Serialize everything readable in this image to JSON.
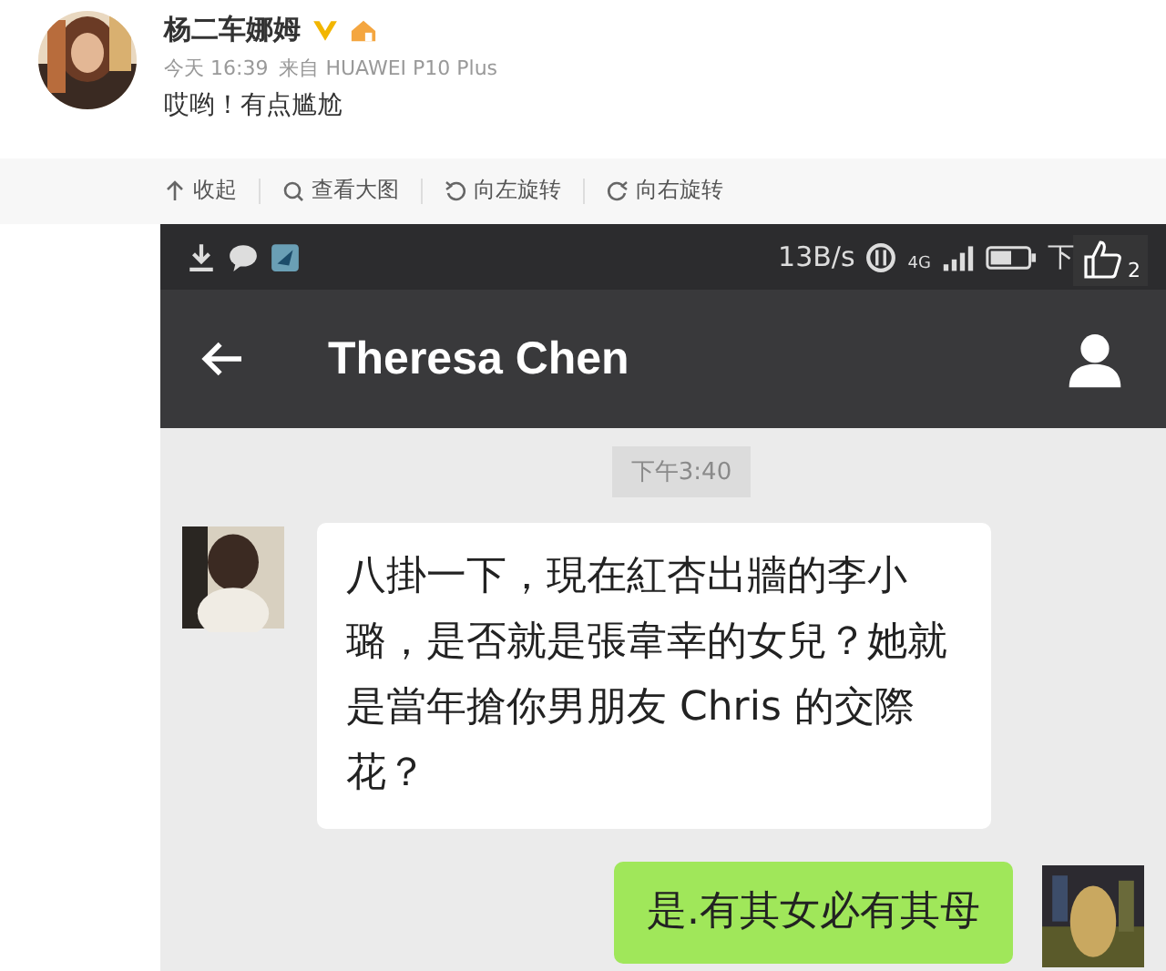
{
  "post": {
    "author": "杨二车娜姆",
    "time": "今天 16:39",
    "source": "来自 HUAWEI P10 Plus",
    "text": "哎哟！有点尴尬"
  },
  "actions": [
    {
      "kind": "collapse",
      "label": "收起"
    },
    {
      "kind": "zoom",
      "label": "查看大图"
    },
    {
      "kind": "rotate_left",
      "label": "向左旋转"
    },
    {
      "kind": "rotate_right",
      "label": "向右旋转"
    }
  ],
  "screenshot": {
    "status": {
      "speed": "13B/s",
      "network": "4G",
      "time": "下"
    },
    "likes": "2",
    "title": "Theresa Chen",
    "timestamp": "下午3:40",
    "messages": [
      {
        "kind": "received",
        "text": "八掛一下，現在紅杏出牆的李小璐，是否就是張韋幸的女兒？她就是當年搶你男朋友 Chris 的交際花？"
      },
      {
        "kind": "sent",
        "text": "是.有其女必有其母"
      }
    ]
  }
}
